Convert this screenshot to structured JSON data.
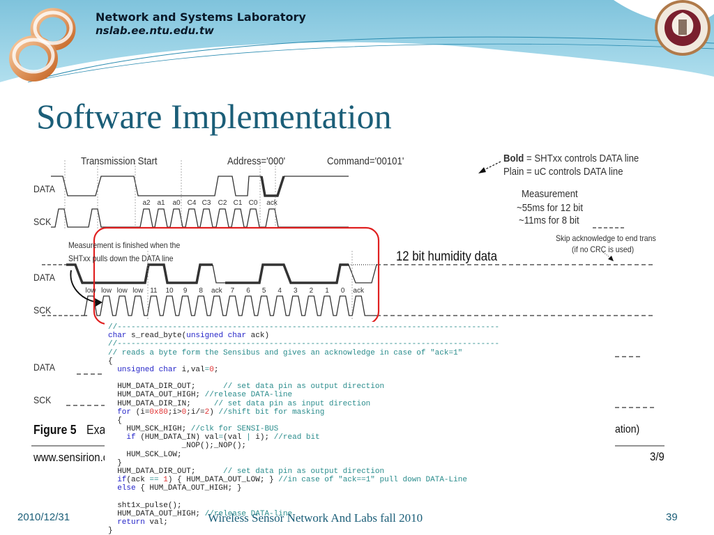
{
  "header": {
    "lab_name": "Network and Systems Laboratory",
    "lab_url": "nslab.ee.ntu.edu.tw",
    "logo_icon": "infinity-ring-logo",
    "seal_icon": "ntu-seal"
  },
  "slide": {
    "title": "Software Implementation"
  },
  "diagram": {
    "top": {
      "data_label": "DATA",
      "sck_label": "SCK",
      "headings": [
        "Transmission Start",
        "Address='000'",
        "Command='00101'"
      ],
      "legend_bold_key": "Bold",
      "legend_bold_rest": " = SHTxx controls DATA line",
      "legend_plain": "Plain = uC controls DATA line",
      "bits": [
        "a2",
        "a1",
        "a0",
        "C4",
        "C3",
        "C2",
        "C1",
        "C0",
        "ack"
      ],
      "measurement": [
        "Measurement",
        "~55ms for 12 bit",
        "~11ms for 8 bit"
      ]
    },
    "bottom": {
      "data_label": "DATA",
      "sck_label": "SCK",
      "note": [
        "Measurement is finished when the",
        "SHTxx pulls down the DATA line"
      ],
      "humidity_label": "12 bit humidity data",
      "skip_note": [
        "Skip acknowledge to end trans",
        "(if no CRC is used)"
      ],
      "bits": [
        "low",
        "low",
        "low",
        "low",
        "11",
        "10",
        "9",
        "8",
        "ack",
        "7",
        "6",
        "5",
        "4",
        "3",
        "2",
        "1",
        "0",
        "ack"
      ]
    },
    "hidden": {
      "data_label": "DATA",
      "sck_label": "SCK",
      "figure_label": "Figure 5",
      "figure_caption_start": "Exar",
      "figure_caption_end": "ation)",
      "source": "www.sensirion.c",
      "page": "3/9"
    },
    "highlight_color": "#e02020"
  },
  "code": {
    "colors": {
      "plain": "#222222",
      "kw": "#2323c8",
      "cm": "#2a8c8c",
      "num": "#e03030"
    },
    "lines": [
      [
        [
          "//-----------------------------------------------------------------------------------",
          "cm"
        ]
      ],
      [
        [
          "char",
          "kw"
        ],
        [
          " s_read_byte(",
          "plain"
        ],
        [
          "unsigned char",
          "kw"
        ],
        [
          " ack)",
          "plain"
        ]
      ],
      [
        [
          "//-----------------------------------------------------------------------------------",
          "cm"
        ]
      ],
      [
        [
          "// reads a byte form the Sensibus and gives an acknowledge in case of \"ack=1\"",
          "cm"
        ]
      ],
      [
        [
          "{",
          "plain"
        ]
      ],
      [
        [
          "  ",
          "plain"
        ],
        [
          "unsigned char",
          "kw"
        ],
        [
          " i,val",
          "plain"
        ],
        [
          "=",
          "cm"
        ],
        [
          "0",
          "num"
        ],
        [
          ";",
          "plain"
        ]
      ],
      [],
      [
        [
          "  HUM_DATA_DIR_OUT;      ",
          "plain"
        ],
        [
          "// set data pin as output direction",
          "cm"
        ]
      ],
      [
        [
          "  HUM_DATA_OUT_HIGH; ",
          "plain"
        ],
        [
          "//release DATA-line",
          "cm"
        ]
      ],
      [
        [
          "  HUM_DATA_DIR_IN;     ",
          "plain"
        ],
        [
          "// set data pin as input direction",
          "cm"
        ]
      ],
      [
        [
          "  ",
          "plain"
        ],
        [
          "for",
          "kw"
        ],
        [
          " (i=",
          "plain"
        ],
        [
          "0x80",
          "num"
        ],
        [
          ";i>",
          "plain"
        ],
        [
          "0",
          "num"
        ],
        [
          ";i/=",
          "plain"
        ],
        [
          "2",
          "num"
        ],
        [
          ") ",
          "plain"
        ],
        [
          "//shift bit for masking",
          "cm"
        ]
      ],
      [
        [
          "  {",
          "plain"
        ]
      ],
      [
        [
          "    HUM_SCK_HIGH; ",
          "plain"
        ],
        [
          "//clk for SENSI-BUS",
          "cm"
        ]
      ],
      [
        [
          "    ",
          "plain"
        ],
        [
          "if",
          "kw"
        ],
        [
          " (HUM_DATA_IN) val",
          "plain"
        ],
        [
          "=",
          "cm"
        ],
        [
          "(val ",
          "plain"
        ],
        [
          "|",
          "cm"
        ],
        [
          " i); ",
          "plain"
        ],
        [
          "//read bit",
          "cm"
        ]
      ],
      [
        [
          "                _NOP();_NOP();",
          "plain"
        ]
      ],
      [
        [
          "    HUM_SCK_LOW;",
          "plain"
        ]
      ],
      [
        [
          "  }",
          "plain"
        ]
      ],
      [
        [
          "  HUM_DATA_DIR_OUT;      ",
          "plain"
        ],
        [
          "// set data pin as output direction",
          "cm"
        ]
      ],
      [
        [
          "  ",
          "plain"
        ],
        [
          "if",
          "kw"
        ],
        [
          "(ack ",
          "plain"
        ],
        [
          "==",
          "cm"
        ],
        [
          " ",
          "plain"
        ],
        [
          "1",
          "num"
        ],
        [
          ") { HUM_DATA_OUT_LOW; } ",
          "plain"
        ],
        [
          "//in case of \"ack==1\" pull down DATA-Line",
          "cm"
        ]
      ],
      [
        [
          "  ",
          "plain"
        ],
        [
          "else",
          "kw"
        ],
        [
          " { HUM_DATA_OUT_HIGH; }",
          "plain"
        ]
      ],
      [],
      [
        [
          "  sht1x_pulse();",
          "plain"
        ]
      ],
      [
        [
          "  HUM_DATA_OUT_HIGH; ",
          "plain"
        ],
        [
          "//release DATA-line",
          "cm"
        ]
      ],
      [
        [
          "  ",
          "plain"
        ],
        [
          "return",
          "kw"
        ],
        [
          " val;",
          "plain"
        ]
      ],
      [
        [
          "}",
          "plain"
        ]
      ]
    ]
  },
  "footer": {
    "date": "2010/12/31",
    "course": "Wireless Sensor Network And Labs fall 2010",
    "page_number": "39"
  }
}
